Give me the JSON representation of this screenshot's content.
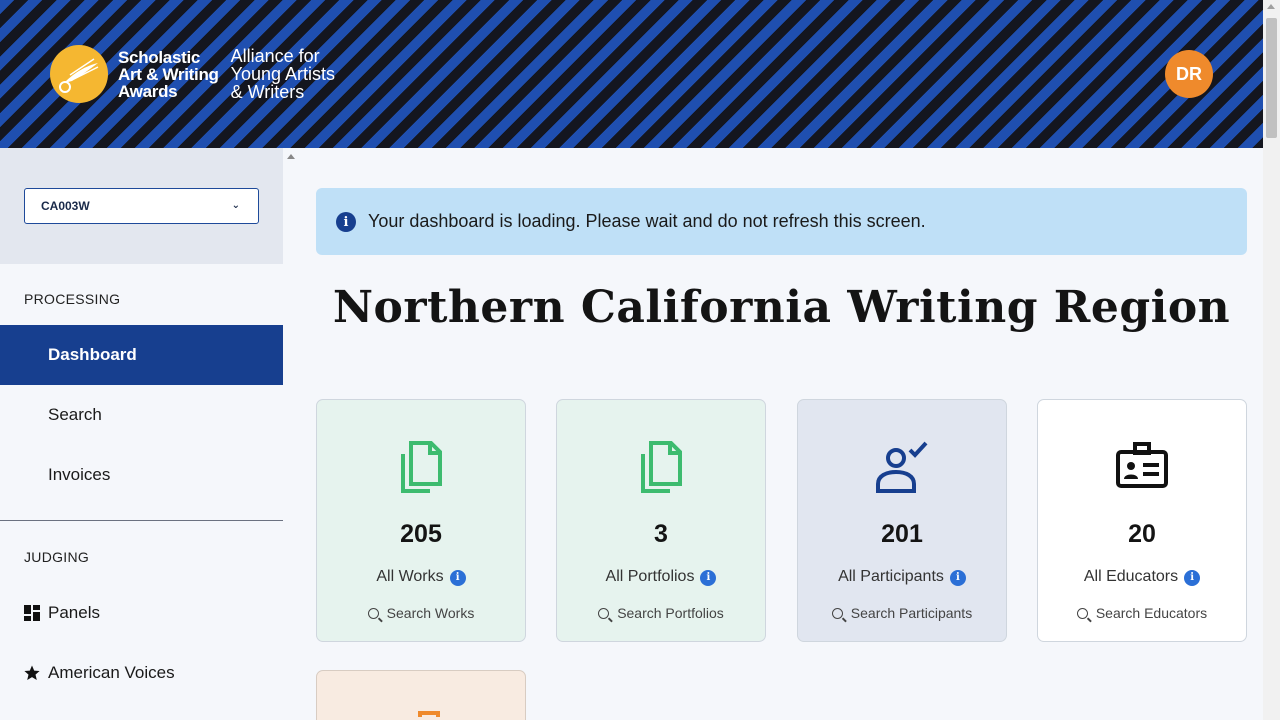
{
  "header": {
    "logo_main": [
      "Scholastic",
      "Art & Writing",
      "Awards"
    ],
    "logo_sub": [
      "Alliance for",
      "Young Artists",
      "& Writers"
    ],
    "avatar_initials": "DR",
    "accent": "#f5b731"
  },
  "sidebar": {
    "region_select": {
      "value": "CA003W"
    },
    "processing_label": "PROCESSING",
    "processing_items": [
      {
        "label": "Dashboard",
        "active": true
      },
      {
        "label": "Search",
        "active": false
      },
      {
        "label": "Invoices",
        "active": false
      }
    ],
    "judging_label": "JUDGING",
    "judging_items": [
      {
        "label": "Panels",
        "icon": "grid-icon"
      },
      {
        "label": "American Voices",
        "icon": "star-icon"
      }
    ]
  },
  "main": {
    "alert_text": "Your dashboard is loading. Please wait and do not refresh this screen.",
    "title": "Northern California Writing Region",
    "cards": [
      {
        "count": "205",
        "label": "All Works",
        "search": "Search Works",
        "icon": "document-icon",
        "bg": "#e6f3ee"
      },
      {
        "count": "3",
        "label": "All Portfolios",
        "search": "Search Portfolios",
        "icon": "document-icon",
        "bg": "#e6f3ee"
      },
      {
        "count": "201",
        "label": "All Participants",
        "search": "Search Participants",
        "icon": "user-check-icon",
        "bg": "#e1e6f0"
      },
      {
        "count": "20",
        "label": "All Educators",
        "search": "Search Educators",
        "icon": "id-card-icon",
        "bg": "#ffffff"
      }
    ]
  }
}
